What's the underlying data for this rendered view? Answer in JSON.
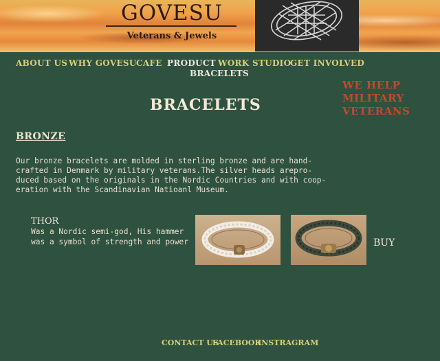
{
  "header": {
    "brand_name": "GOVESU",
    "tagline": "Veterans & Jewels"
  },
  "nav": {
    "items": [
      {
        "label": "ABOUT US"
      },
      {
        "label": "WHY GOVESU"
      },
      {
        "label": "CAFE"
      },
      {
        "label": "PRODUCT"
      },
      {
        "label": "WORK STUDIO"
      },
      {
        "label": "GET INVOLVED"
      }
    ],
    "sub_item": "BRACELETS"
  },
  "sidebar": {
    "help_line1": "WE HELP",
    "help_line2": "MILITARY",
    "help_line3": "VETERANS"
  },
  "main": {
    "page_title": "BRACELETS",
    "section_title": "BRONZE",
    "intro": "Our bronze bracelets are molded in sterling bronze and are hand-\ncrafted in Denmark by military veterans.The silver heads arepro-\nduced based on the originals in the Nordic Countries and with coop-\neration with the Scandinavian Natioanl Museum.",
    "product": {
      "name": "THOR",
      "description": "Was a Nordic semi-god, His hammer was a symbol of strength and power",
      "buy_label": "BUY"
    }
  },
  "footer": {
    "contact": "CONTACT US",
    "facebook": "FACEBOOK",
    "instagram": "INSTRAGRAM"
  }
}
